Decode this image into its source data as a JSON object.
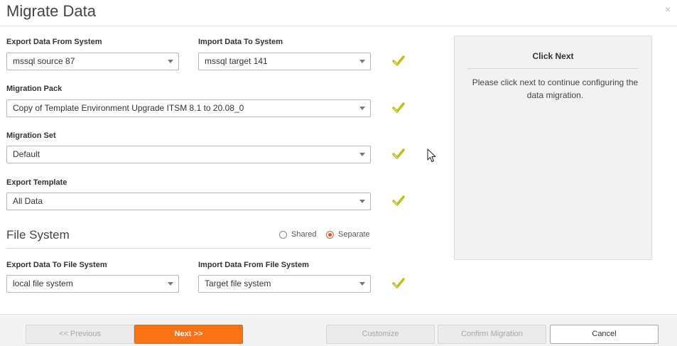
{
  "dialog": {
    "title": "Migrate Data",
    "close_glyph": "×"
  },
  "form": {
    "export_system": {
      "label": "Export Data From System",
      "value": "mssql source 87"
    },
    "import_system": {
      "label": "Import Data To System",
      "value": "mssql target 141"
    },
    "migration_pack": {
      "label": "Migration Pack",
      "value": "Copy of Template Environment Upgrade ITSM 8.1 to 20.08_0"
    },
    "migration_set": {
      "label": "Migration Set",
      "value": "Default"
    },
    "export_template": {
      "label": "Export Template",
      "value": "All Data"
    },
    "file_system": {
      "title": "File System",
      "radio_shared": "Shared",
      "radio_separate": "Separate",
      "selected": "Separate",
      "export_fs": {
        "label": "Export Data To File System",
        "value": "local file system"
      },
      "import_fs": {
        "label": "Import Data From File System",
        "value": "Target file system"
      }
    }
  },
  "help": {
    "title": "Click Next",
    "text": "Please click next to continue configuring the data migration."
  },
  "footer": {
    "previous_label": "<< Previous",
    "next_label": "Next >>",
    "customize_label": "Customize",
    "confirm_label": "Confirm Migration",
    "cancel_label": "Cancel"
  },
  "colors": {
    "accent": "#f97316",
    "check": "#c8c800",
    "radio_on": "#e8521f"
  },
  "icons": [
    "close-icon",
    "check-icon",
    "chevron-down-icon",
    "cursor-icon"
  ]
}
